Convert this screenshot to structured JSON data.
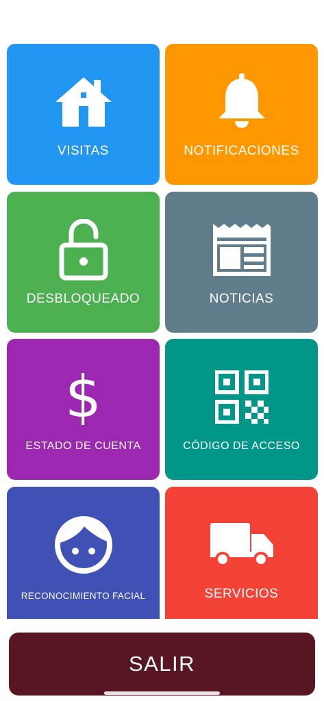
{
  "menu": {
    "tiles": [
      {
        "id": "visitas",
        "label": "VISITAS",
        "color": "#2196f3",
        "icon": "home-icon"
      },
      {
        "id": "notificaciones",
        "label": "NOTIFICACIONES",
        "color": "#ff9800",
        "icon": "bell-icon"
      },
      {
        "id": "desbloqueado",
        "label": "DESBLOQUEADO",
        "color": "#4caf50",
        "icon": "unlock-icon"
      },
      {
        "id": "noticias",
        "label": "NOTICIAS",
        "color": "#607d8b",
        "icon": "newspaper-icon"
      },
      {
        "id": "estado-de-cuenta",
        "label": "ESTADO DE CUENTA",
        "color": "#9c27b0",
        "icon": "dollar-icon"
      },
      {
        "id": "codigo-de-acceso",
        "label": "CÓDIGO DE ACCESO",
        "color": "#009688",
        "icon": "qr-code-icon"
      },
      {
        "id": "reconocimiento-facial",
        "label": "RECONOCIMIENTO FACIAL",
        "color": "#3f51b5",
        "icon": "face-icon"
      },
      {
        "id": "servicios",
        "label": "SERVICIOS",
        "color": "#f44336",
        "icon": "truck-icon"
      }
    ]
  },
  "footer": {
    "logout_label": "SALIR",
    "logout_color": "#581522"
  }
}
